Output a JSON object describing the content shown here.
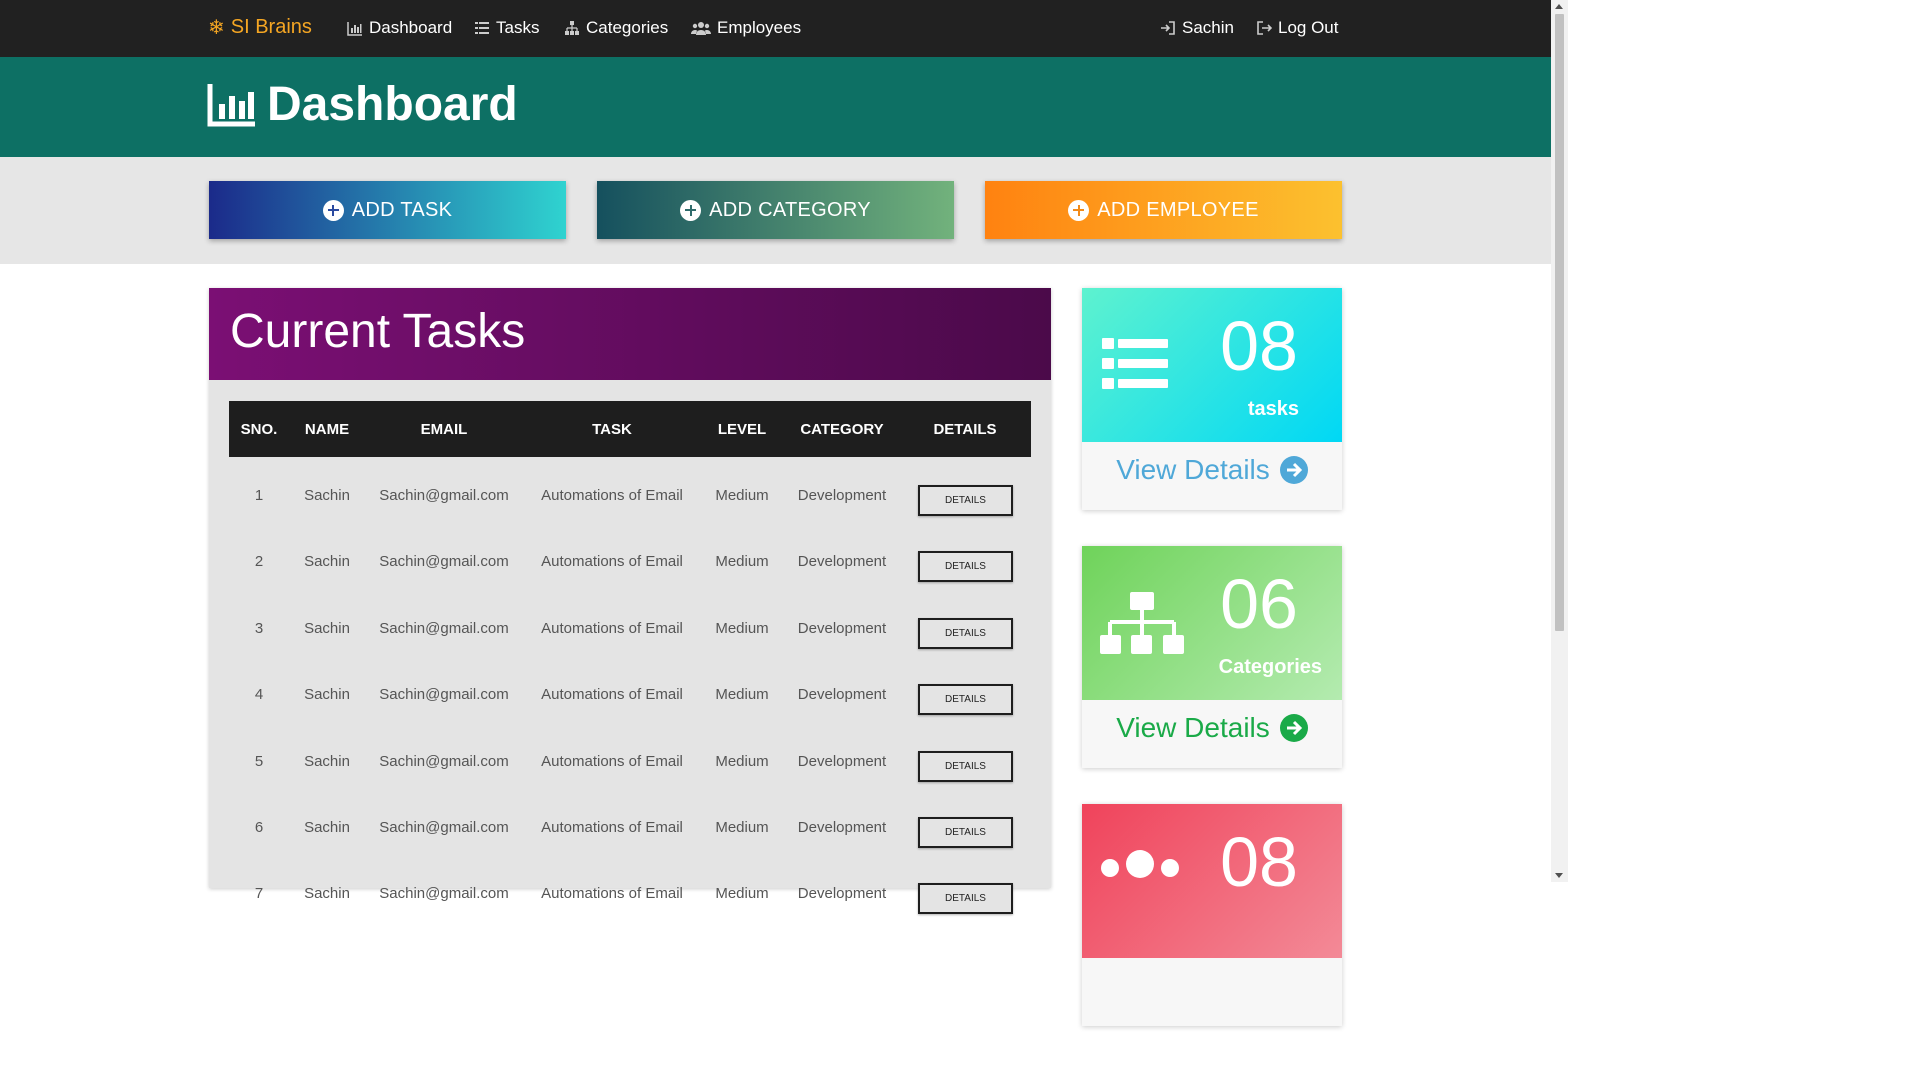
{
  "brand": {
    "label": "SI Brains",
    "color": "#f5a623"
  },
  "nav": {
    "dashboard": "Dashboard",
    "tasks": "Tasks",
    "categories": "Categories",
    "employees": "Employees",
    "user": "Sachin",
    "logout": "Log Out"
  },
  "header": {
    "title": "Dashboard"
  },
  "actions": {
    "add_task": "ADD TASK",
    "add_category": "ADD CATEGORY",
    "add_employee": "ADD EMPLOYEE"
  },
  "tasks_panel": {
    "title": "Current Tasks",
    "columns": [
      "SNO.",
      "NAME",
      "EMAIL",
      "TASK",
      "LEVEL",
      "CATEGORY",
      "DETAILS"
    ],
    "rows": [
      {
        "sno": "1",
        "name": "Sachin",
        "email": "Sachin@gmail.com",
        "task": "Automations of Email",
        "level": "Medium",
        "category": "Development",
        "details": "DETAILS"
      },
      {
        "sno": "2",
        "name": "Sachin",
        "email": "Sachin@gmail.com",
        "task": "Automations of Email",
        "level": "Medium",
        "category": "Development",
        "details": "DETAILS"
      },
      {
        "sno": "3",
        "name": "Sachin",
        "email": "Sachin@gmail.com",
        "task": "Automations of Email",
        "level": "Medium",
        "category": "Development",
        "details": "DETAILS"
      },
      {
        "sno": "4",
        "name": "Sachin",
        "email": "Sachin@gmail.com",
        "task": "Automations of Email",
        "level": "Medium",
        "category": "Development",
        "details": "DETAILS"
      },
      {
        "sno": "5",
        "name": "Sachin",
        "email": "Sachin@gmail.com",
        "task": "Automations of Email",
        "level": "Medium",
        "category": "Development",
        "details": "DETAILS"
      },
      {
        "sno": "6",
        "name": "Sachin",
        "email": "Sachin@gmail.com",
        "task": "Automations of Email",
        "level": "Medium",
        "category": "Development",
        "details": "DETAILS"
      },
      {
        "sno": "7",
        "name": "Sachin",
        "email": "Sachin@gmail.com",
        "task": "Automations of Email",
        "level": "Medium",
        "category": "Development",
        "details": "DETAILS"
      }
    ]
  },
  "cards": {
    "tasks": {
      "count": "08",
      "label": "tasks",
      "link": "View Details",
      "link_color": "#4fa8d8"
    },
    "categories": {
      "count": "06",
      "label": "Categories",
      "link": "View Details",
      "link_color": "#1aaa48"
    },
    "employees": {
      "count": "08"
    }
  }
}
